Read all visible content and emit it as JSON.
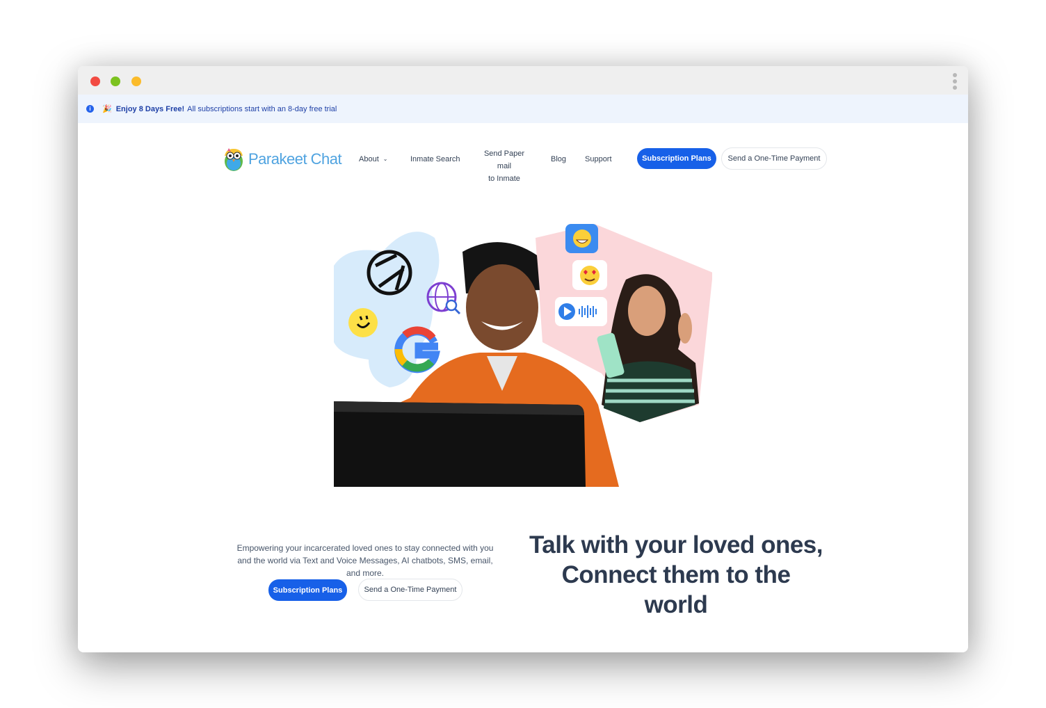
{
  "window": {
    "controls": [
      "close",
      "minimize",
      "maximize"
    ]
  },
  "banner": {
    "icon": "info-icon",
    "emoji": "🎉",
    "bold_text": "Enjoy 8 Days Free!",
    "text": "All subscriptions start with an 8-day free trial"
  },
  "nav": {
    "logo_text": "Parakeet Chat",
    "about": "About",
    "inmate_search": "Inmate Search",
    "paper_mail_line1": "Send Paper mail",
    "paper_mail_line2": "to Inmate",
    "blog": "Blog",
    "support": "Support",
    "subscription_plans": "Subscription Plans",
    "one_time_payment": "Send a One-Time Payment"
  },
  "hero": {
    "tagline": "Empowering your incarcerated loved ones to stay connected with you and the world via Text and Voice Messages, AI chatbots, SMS, email, and more.",
    "subscription_plans": "Subscription Plans",
    "one_time_payment": "Send a One-Time Payment",
    "headline_line1": "Talk with your loved ones,",
    "headline_line2": "Connect them to the",
    "headline_line3": "world"
  },
  "colors": {
    "primary": "#1760e8",
    "banner_bg": "#eef4fd",
    "logo": "#4fa3e0",
    "headline": "#2d3a4f"
  }
}
